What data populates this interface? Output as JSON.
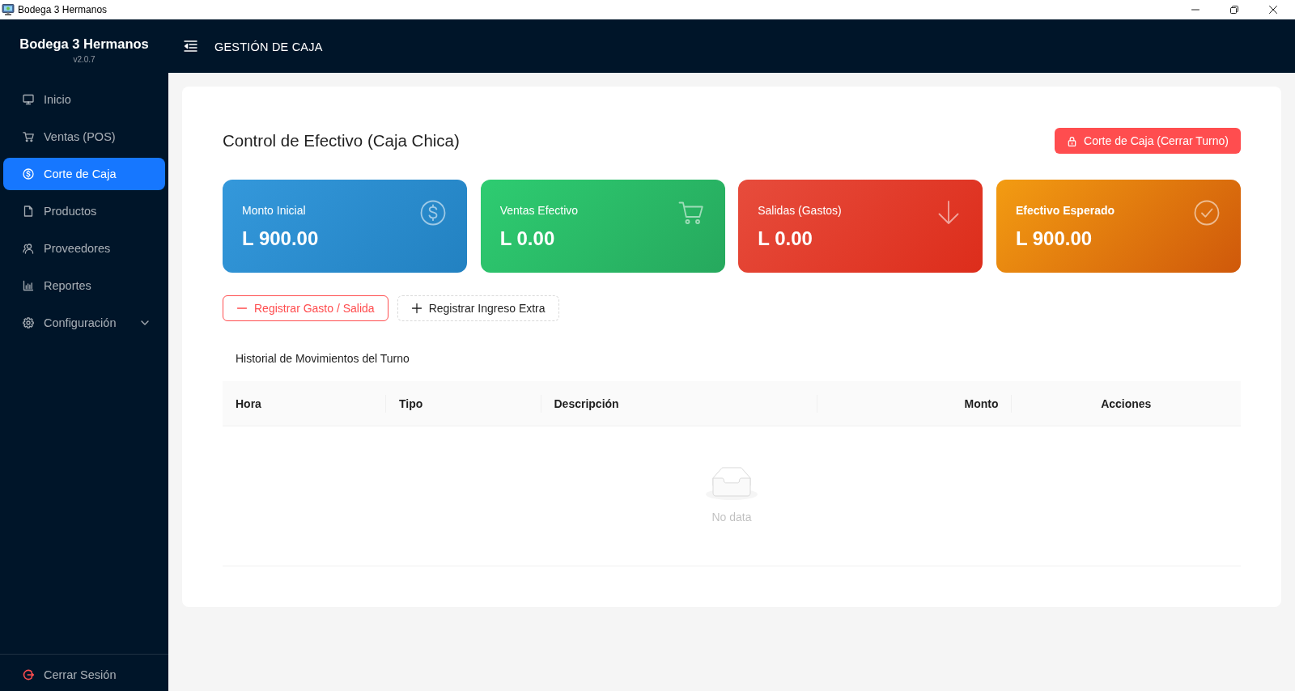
{
  "window": {
    "title": "Bodega 3 Hermanos"
  },
  "sidebar": {
    "brand": "Bodega 3 Hermanos",
    "version": "v2.0.7",
    "items": [
      {
        "label": "Inicio",
        "kind": "link",
        "selected": false
      },
      {
        "label": "Ventas (POS)",
        "kind": "link",
        "selected": false
      },
      {
        "label": "Corte de Caja",
        "kind": "link",
        "selected": true
      },
      {
        "label": "Productos",
        "kind": "link",
        "selected": false
      },
      {
        "label": "Proveedores",
        "kind": "link",
        "selected": false
      },
      {
        "label": "Reportes",
        "kind": "link",
        "selected": false
      },
      {
        "label": "Configuración",
        "kind": "submenu",
        "selected": false,
        "expanded": false
      }
    ],
    "logout": {
      "label": "Cerrar Sesión"
    }
  },
  "header": {
    "title": "GESTIÓN DE CAJA"
  },
  "page": {
    "title": "Control de Efectivo (Caja Chica)",
    "close_shift_button": "Corte de Caja (Cerrar Turno)",
    "stats": [
      {
        "label": "Monto Inicial",
        "value": "L 900.00",
        "color": "#3498db",
        "highlighted": false
      },
      {
        "label": "Ventas Efectivo",
        "value": "L 0.00",
        "color": "#2ecc71",
        "highlighted": false
      },
      {
        "label": "Salidas (Gastos)",
        "value": "L 0.00",
        "color": "#e74c3c",
        "highlighted": false
      },
      {
        "label": "Efectivo Esperado",
        "value": "L 900.00",
        "color": "#f39c12",
        "highlighted": true
      }
    ],
    "actions": [
      {
        "label": "Registrar Gasto / Salida",
        "kind": "danger"
      },
      {
        "label": "Registrar Ingreso Extra",
        "kind": "dashed"
      }
    ],
    "history": {
      "title": "Historial de Movimientos del Turno",
      "columns": [
        {
          "label": "Hora",
          "kind": "text"
        },
        {
          "label": "Tipo",
          "kind": "text"
        },
        {
          "label": "Descripción",
          "kind": "text"
        },
        {
          "label": "Monto",
          "kind": "amount"
        },
        {
          "label": "Acciones",
          "kind": "actions"
        }
      ],
      "empty_text": "No data"
    }
  }
}
